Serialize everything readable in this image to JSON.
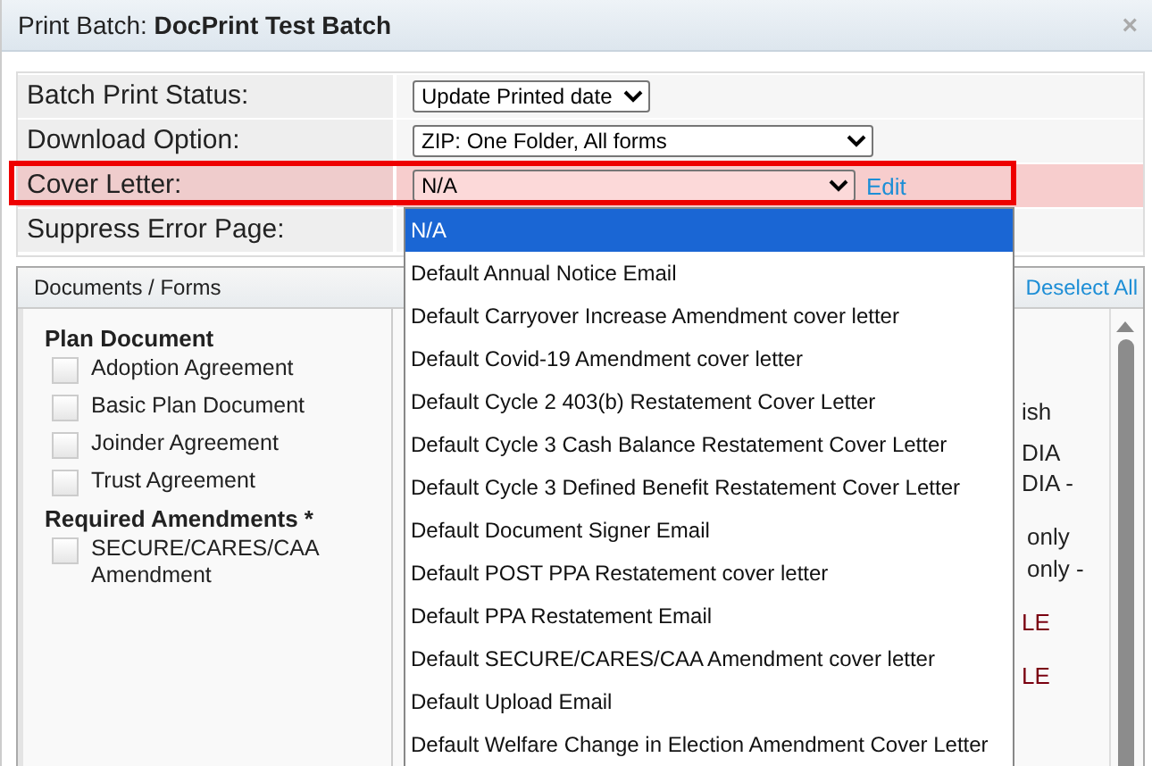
{
  "dialog": {
    "title": "Print Batch: **DocPrint Test Batch**",
    "close": "×"
  },
  "settings": [
    {
      "label": "Batch Print Status:",
      "value": "Update Printed date",
      "highlighted": false
    },
    {
      "label": "Download Option:",
      "value": "ZIP: One Folder, All forms",
      "highlighted": false
    },
    {
      "label": "Cover Letter:",
      "value": "N/A",
      "highlighted": true,
      "link": "Edit"
    },
    {
      "label": "Suppress Error Page:",
      "highlighted": false
    }
  ],
  "dropdown_options": [
    {
      "label": "N/A",
      "selected": true
    },
    {
      "label": "Default Annual Notice Email",
      "selected": false
    },
    {
      "label": "Default Carryover Increase Amendment cover letter",
      "selected": false
    },
    {
      "label": "Default Covid-19 Amendment cover letter",
      "selected": false
    },
    {
      "label": "Default Cycle 2 403(b) Restatement Cover Letter",
      "selected": false
    },
    {
      "label": "Default Cycle 3 Cash Balance Restatement Cover Letter",
      "selected": false
    },
    {
      "label": "Default Cycle 3 Defined Benefit Restatement Cover Letter",
      "selected": false
    },
    {
      "label": "Default Document Signer Email",
      "selected": false
    },
    {
      "label": "Default POST PPA Restatement cover letter",
      "selected": false
    },
    {
      "label": "Default PPA Restatement Email",
      "selected": false
    },
    {
      "label": "Default SECURE/CARES/CAA Amendment cover letter",
      "selected": false
    },
    {
      "label": "Default Upload Email",
      "selected": false
    },
    {
      "label": "Default Welfare Change in Election Amendment Cover Letter",
      "selected": false
    }
  ],
  "documents": {
    "title": "Documents / Forms",
    "action": "Deselect All",
    "groups": [
      {
        "heading": "Plan Document",
        "items": [
          {
            "label": "Adoption Agreement",
            "checked": false
          },
          {
            "label": "Basic Plan Document",
            "checked": false
          },
          {
            "label": "Joinder Agreement",
            "checked": false
          },
          {
            "label": "Trust Agreement",
            "checked": false
          }
        ]
      },
      {
        "heading": "Required Amendments *",
        "items": [
          {
            "label": "SECURE/CARES/CAA Amendment",
            "checked": false
          }
        ]
      }
    ],
    "fragments": [
      {
        "text": "ish",
        "kind": "normal"
      },
      {
        "text": "DIA",
        "kind": "normal"
      },
      {
        "text": "DIA -",
        "kind": "normal"
      },
      {
        "text": "only",
        "kind": "normal"
      },
      {
        "text": "only -",
        "kind": "normal"
      },
      {
        "text": "LE",
        "kind": "alert"
      },
      {
        "text": "LE",
        "kind": "alert"
      }
    ]
  }
}
